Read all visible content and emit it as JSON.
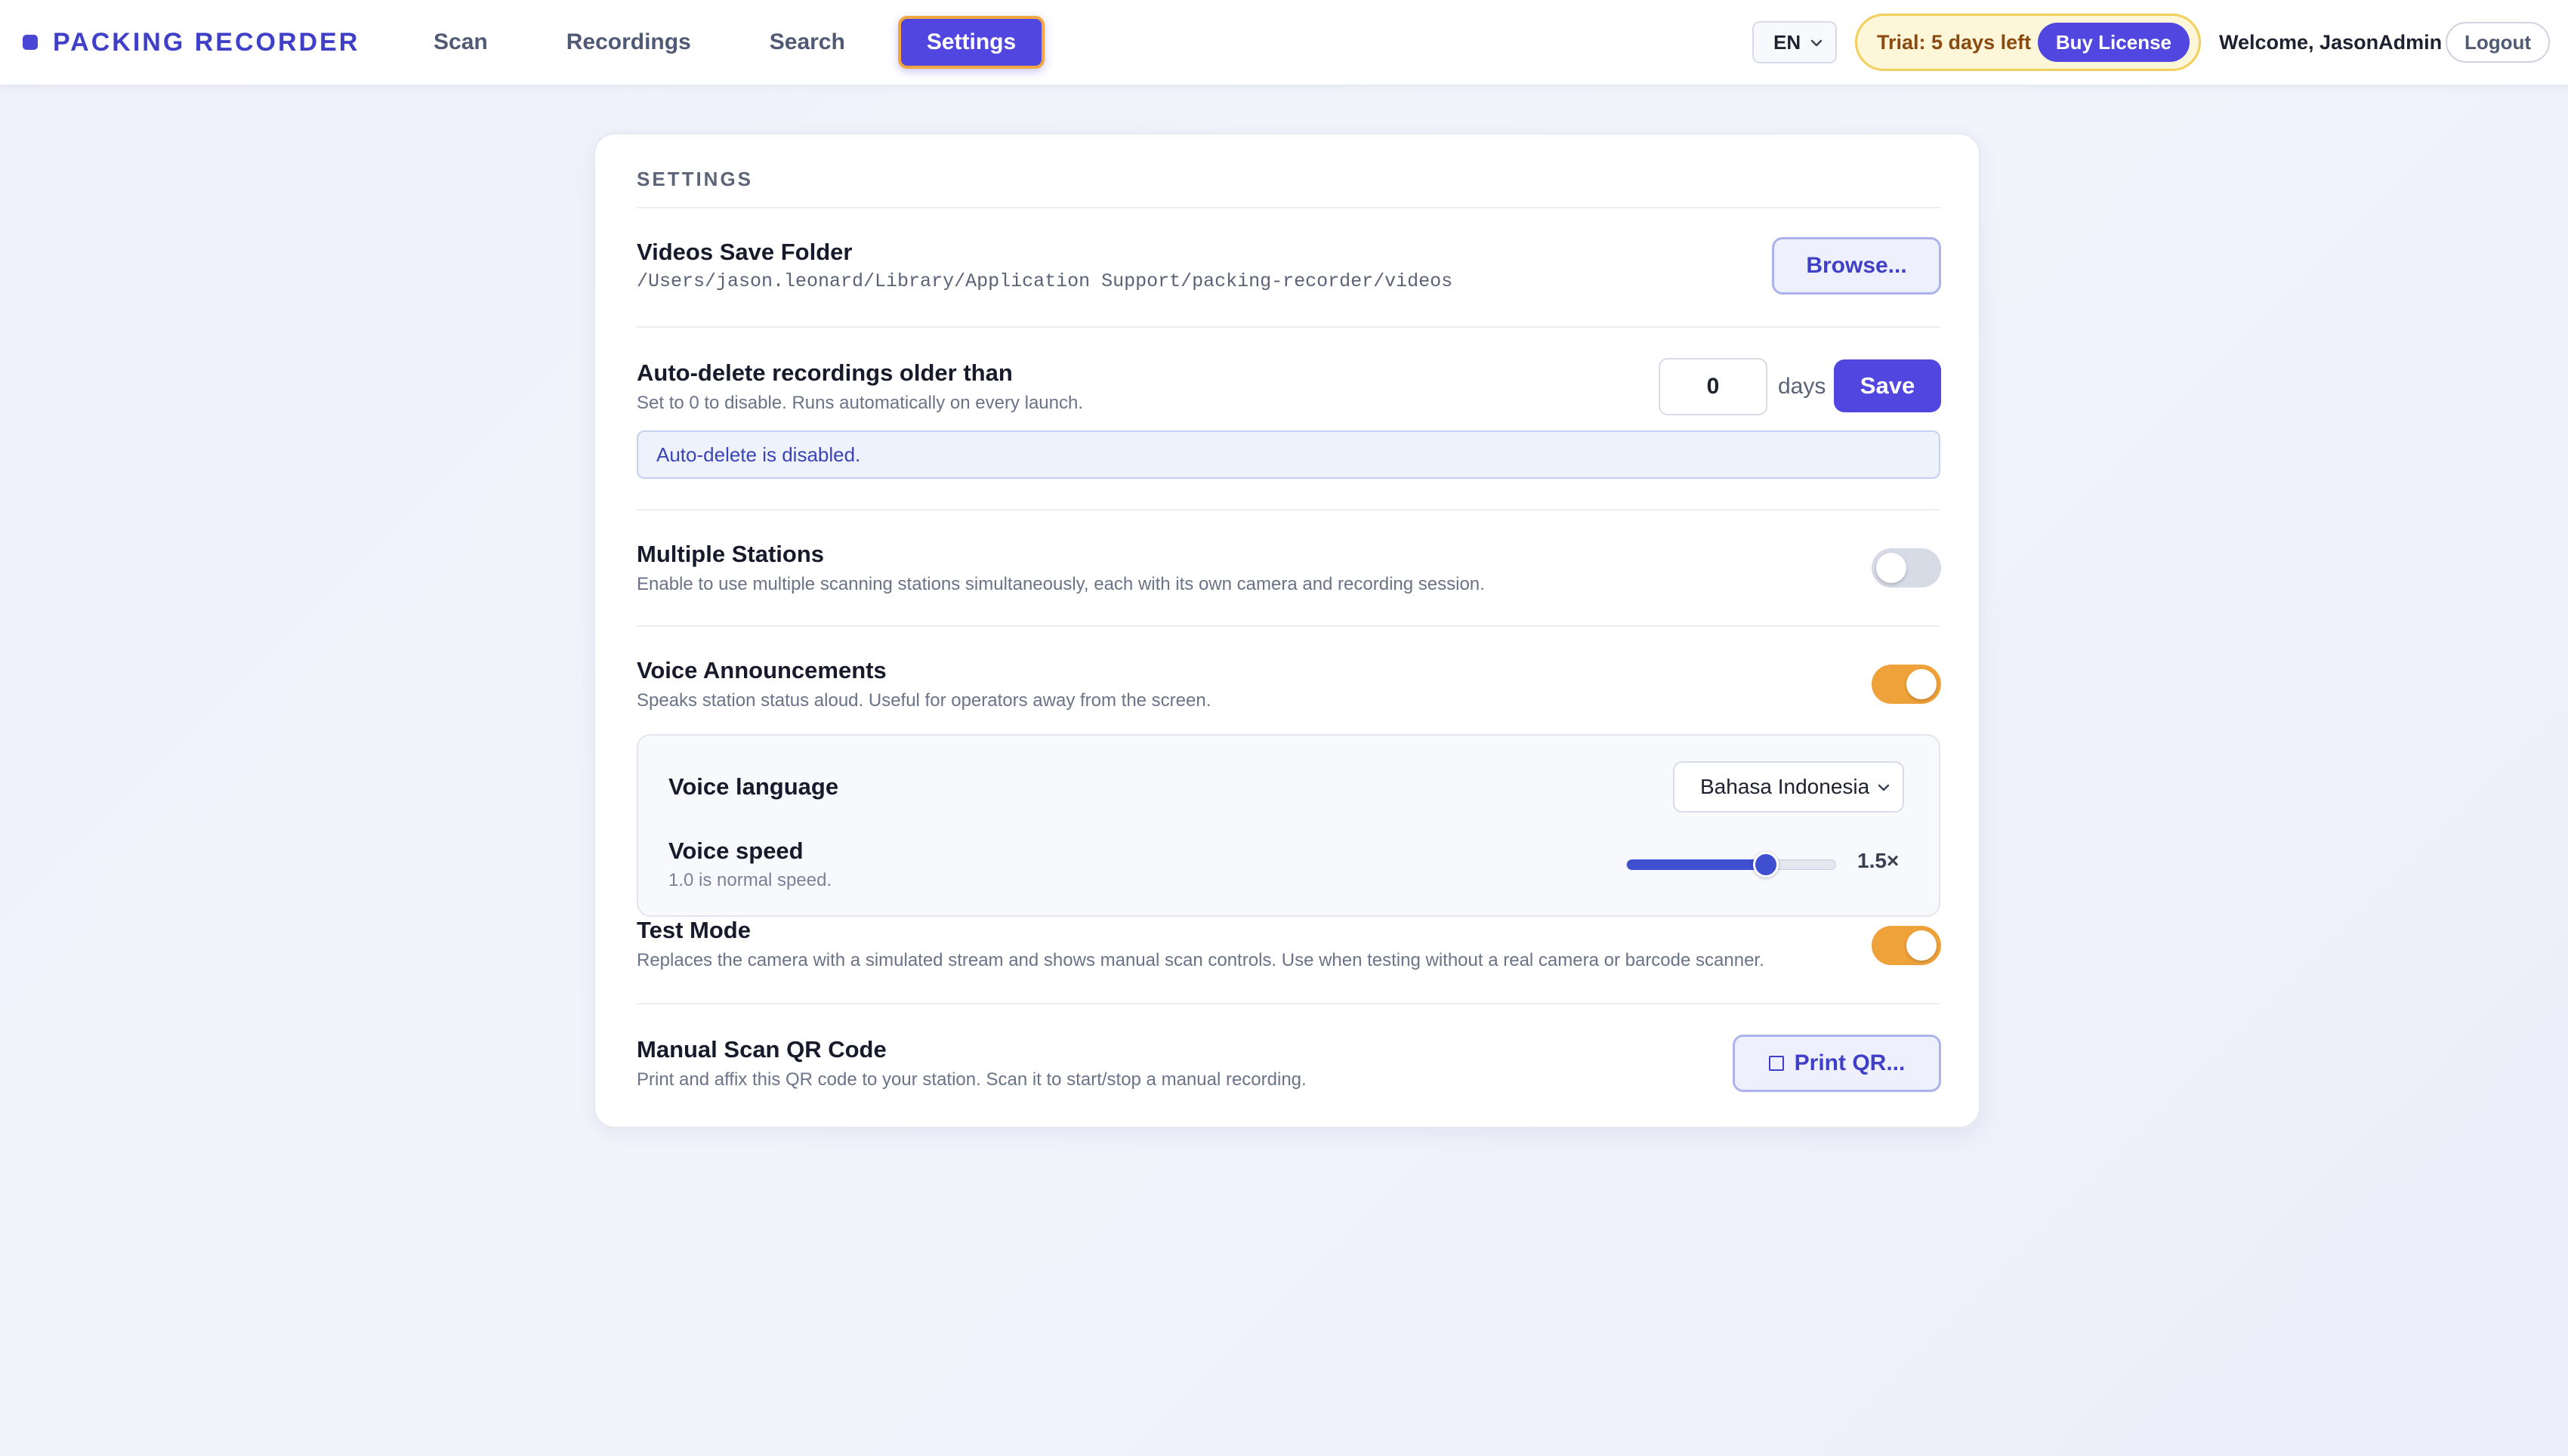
{
  "app": {
    "name": "PACKING RECORDER"
  },
  "nav": {
    "items": [
      {
        "label": "Scan"
      },
      {
        "label": "Recordings"
      },
      {
        "label": "Search"
      },
      {
        "label": "Settings"
      }
    ],
    "active": "Settings"
  },
  "header": {
    "language": "EN",
    "trial_text": "Trial: 5 days left",
    "buy_label": "Buy License",
    "welcome": "Welcome, JasonAdmin",
    "logout_label": "Logout"
  },
  "settings": {
    "title": "SETTINGS",
    "videos_folder": {
      "title": "Videos Save Folder",
      "path": "/Users/jason.leonard/Library/Application Support/packing-recorder/videos",
      "browse_label": "Browse..."
    },
    "auto_delete": {
      "title": "Auto-delete recordings older than",
      "desc": "Set to 0 to disable. Runs automatically on every launch.",
      "value": "0",
      "unit": "days",
      "save_label": "Save",
      "status": "Auto-delete is disabled."
    },
    "multiple_stations": {
      "title": "Multiple Stations",
      "desc": "Enable to use multiple scanning stations simultaneously, each with its own camera and recording session.",
      "enabled": false
    },
    "voice_announcements": {
      "title": "Voice Announcements",
      "desc": "Speaks station status aloud. Useful for operators away from the screen.",
      "enabled": true,
      "language_label": "Voice language",
      "language_value": "Bahasa Indonesia",
      "speed_label": "Voice speed",
      "speed_desc": "1.0 is normal speed.",
      "speed_value": 1.5,
      "speed_min": 0.5,
      "speed_max": 2.0,
      "speed_display": "1.5×"
    },
    "test_mode": {
      "title": "Test Mode",
      "desc": "Replaces the camera with a simulated stream and shows manual scan controls. Use when testing without a real camera or barcode scanner.",
      "enabled": true
    },
    "manual_qr": {
      "title": "Manual Scan QR Code",
      "desc": "Print and affix this QR code to your station. Scan it to start/stop a manual recording.",
      "print_label": "Print QR..."
    }
  },
  "colors": {
    "accent": "#5147e0",
    "toggle_on": "#f0a23a",
    "toggle_off": "#d7dbe6",
    "trial_bg": "#fdf6d8"
  }
}
